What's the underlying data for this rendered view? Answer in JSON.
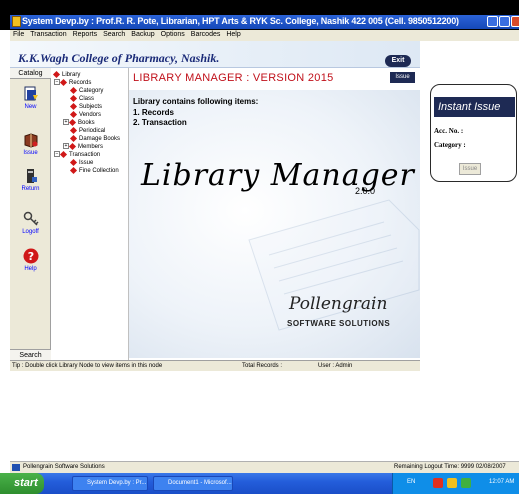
{
  "window": {
    "title": "System Devp.by : Prof.R. R. Pote, Librarian, HPT Arts & RYK Sc. College, Nashik 422 005 (Cell. 9850512200)"
  },
  "menu": [
    "File",
    "Transaction",
    "Reports",
    "Search",
    "Backup",
    "Options",
    "Barcodes",
    "Help"
  ],
  "header": {
    "college": "K.K.Wagh College of Pharmacy, Nashik.",
    "exit_label": "Exit"
  },
  "sidebar": {
    "catalog_tab": "Catalog",
    "search_tab": "Search",
    "buttons": [
      {
        "label": "New",
        "icon": "new-document-icon"
      },
      {
        "label": "Issue",
        "icon": "book-issue-icon"
      },
      {
        "label": "Return",
        "icon": "book-return-icon"
      },
      {
        "label": "Logoff",
        "icon": "key-logoff-icon"
      },
      {
        "label": "Help",
        "icon": "help-question-icon"
      }
    ]
  },
  "tree": {
    "root": "Library",
    "records": "Records",
    "category": "Category",
    "class": "Class",
    "subjects": "Subjects",
    "vendors": "Vendors",
    "books": "Books",
    "periodical": "Periodical",
    "damage_books": "Damage Books",
    "members": "Members",
    "transaction": "Transaction",
    "issue": "Issue",
    "fine_collection": "Fine Collection"
  },
  "main": {
    "title": "LIBRARY MANAGER :  VERSION 2015",
    "issue_tab": "Issue",
    "heading": "Library contains following items:",
    "items": [
      "1. Records",
      "2. Transaction"
    ],
    "brand": "Library Manager",
    "version": "2.0.0",
    "company": "Pollengrain",
    "company_sub": "SOFTWARE SOLUTIONS"
  },
  "status": {
    "tip": "Tip : Double click Library Node to view items in this node",
    "total_records": "Total Records :",
    "user": "User : Admin"
  },
  "instant_issue": {
    "title": "Instant Issue",
    "acc_no_label": "Acc. No. :",
    "category_label": "Category :",
    "button_label": "Issue"
  },
  "bottom": {
    "left": "Pollengrain Software Solutions",
    "right": "Remaining Logout Time: 9999   02/08/2007"
  },
  "taskbar": {
    "start": "start",
    "tasks": [
      "System Devp.by : Pr...",
      "Document1 - Microsof..."
    ],
    "lang": "EN",
    "time": "12:07 AM"
  },
  "colors": {
    "accent_red": "#c0101a",
    "navy": "#1e2a54",
    "titlebar_blue": "#245edb"
  }
}
